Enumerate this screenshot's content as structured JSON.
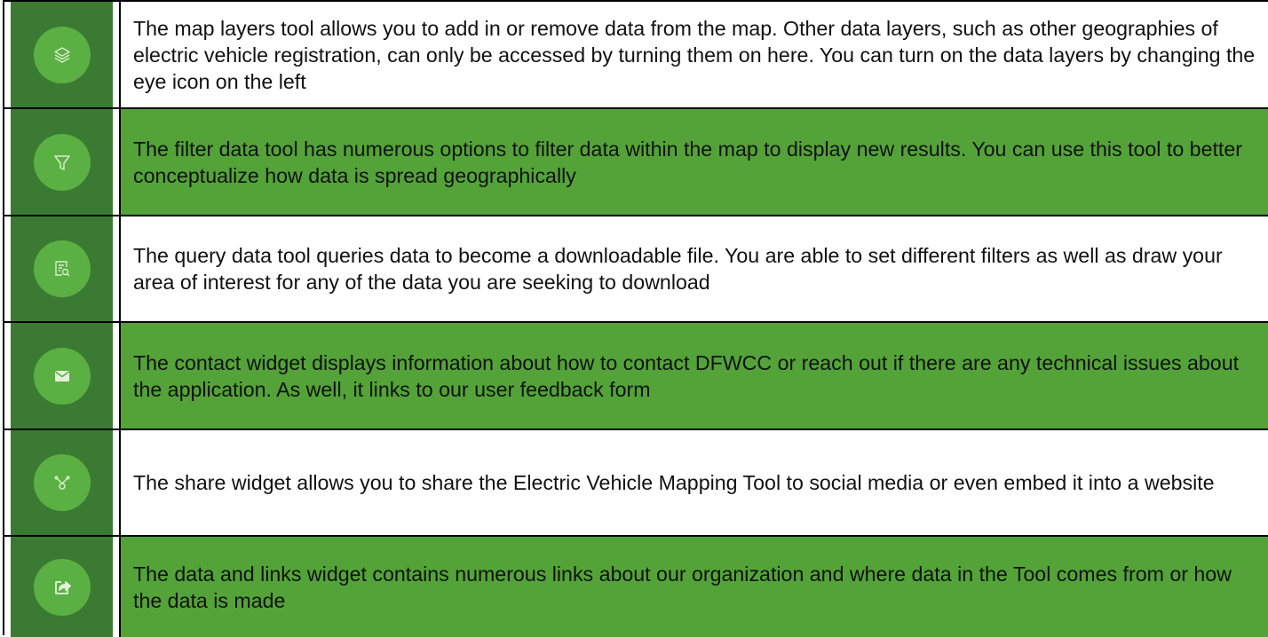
{
  "rows": [
    {
      "icon": "layers-icon",
      "text": "The map layers tool allows you to add in or remove data from the map. Other data layers, such as other geographies of electric vehicle registration, can only be accessed by turning them on here. You can turn on the data layers by changing the eye icon on the left"
    },
    {
      "icon": "filter-icon",
      "text": "The filter data tool has numerous options to filter data within the map to display new results. You can use this tool to better conceptualize how data is spread geographically"
    },
    {
      "icon": "query-icon",
      "text": "The query data tool queries data to become a downloadable file. You are able to set different filters as well as draw your area of interest for any of the data you are seeking to download"
    },
    {
      "icon": "mail-icon",
      "text": "The contact widget displays information about how to contact DFWCC or reach out if there are any technical issues about the application. As well, it links to our user feedback form"
    },
    {
      "icon": "share-icon",
      "text": "The share widget allows you to share the Electric Vehicle Mapping Tool to social media or even embed it into a website"
    },
    {
      "icon": "links-icon",
      "text": "The data and links widget contains numerous links about our organization and where data in the Tool comes from or how the data is made"
    }
  ],
  "colors": {
    "green_row": "#53a338",
    "icon_square": "#3a7a33",
    "icon_circle": "#5bb043",
    "border": "#000000"
  }
}
